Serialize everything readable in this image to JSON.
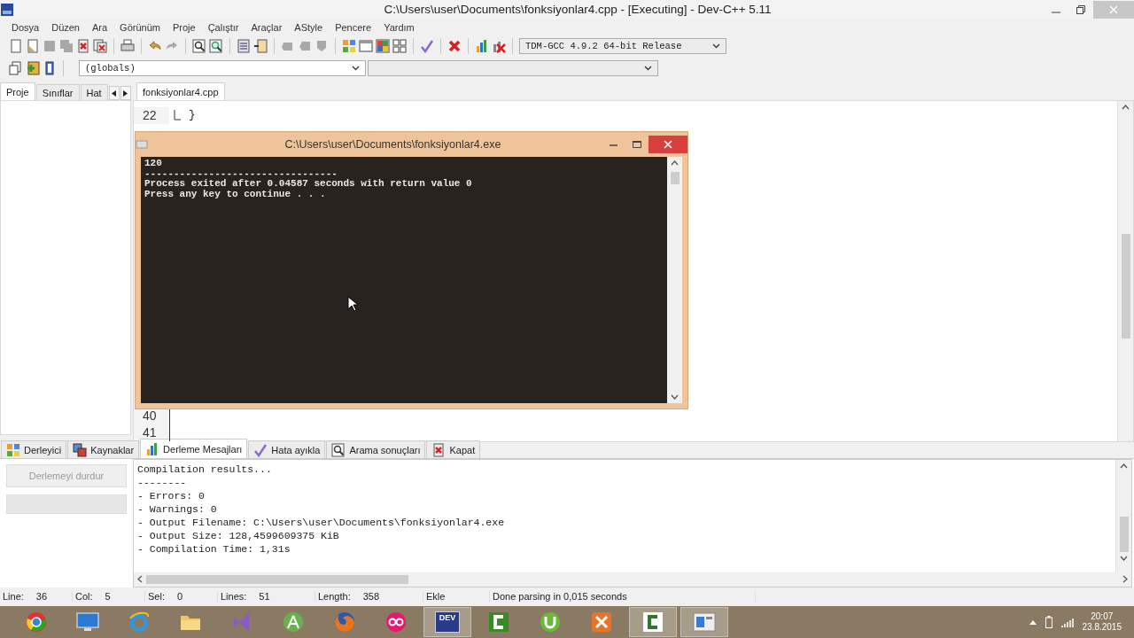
{
  "window": {
    "title": "C:\\Users\\user\\Documents\\fonksiyonlar4.cpp - [Executing] - Dev-C++ 5.11"
  },
  "menu": [
    "Dosya",
    "Düzen",
    "Ara",
    "Görünüm",
    "Proje",
    "Çalıştır",
    "Araçlar",
    "AStyle",
    "Pencere",
    "Yardım"
  ],
  "compiler_select": {
    "value": "TDM-GCC 4.9.2 64-bit Release"
  },
  "scope_select": {
    "value": "(globals)"
  },
  "left_tabs": [
    {
      "label": "Proje",
      "selected": true
    },
    {
      "label": "Sınıflar",
      "selected": false
    },
    {
      "label": "Hat",
      "selected": false
    }
  ],
  "editor_tabs": [
    {
      "label": "fonksiyonlar4.cpp",
      "selected": true
    }
  ],
  "editor_lines": [
    {
      "number": "22",
      "code": "}",
      "fold_end": true,
      "in_fold": false
    },
    {
      "number": "40",
      "fold_end": false,
      "in_fold": true
    },
    {
      "number": "41",
      "fold_end": false,
      "in_fold": true
    }
  ],
  "console": {
    "title": "C:\\Users\\user\\Documents\\fonksiyonlar4.exe",
    "lines": [
      "120",
      "---------------------------------",
      "Process exited after 0.04587 seconds with return value 0",
      "Press any key to continue . . ."
    ]
  },
  "bottom_tabs": [
    {
      "label": "Derleyici",
      "selected": false
    },
    {
      "label": "Kaynaklar",
      "selected": false
    },
    {
      "label": "Derleme Mesajları",
      "selected": true
    },
    {
      "label": "Hata ayıkla",
      "selected": false
    },
    {
      "label": "Arama sonuçları",
      "selected": false
    },
    {
      "label": "Kapat",
      "selected": false
    }
  ],
  "stop_button": {
    "label": "Derlemeyi durdur",
    "disabled": true
  },
  "progress": {
    "level": 0
  },
  "compile_log": [
    "Compilation results...",
    "--------",
    "- Errors: 0",
    "- Warnings: 0",
    "- Output Filename: C:\\Users\\user\\Documents\\fonksiyonlar4.exe",
    "- Output Size: 128,4599609375 KiB",
    "- Compilation Time: 1,31s"
  ],
  "status_bar": [
    {
      "label": "Line:",
      "value": "36"
    },
    {
      "label": "Col:",
      "value": "5"
    },
    {
      "label": "Sel:",
      "value": "0"
    },
    {
      "label": "Lines:",
      "value": "51"
    },
    {
      "label": "Length:",
      "value": "358"
    },
    {
      "label": "Ekle"
    },
    {
      "label": "Done parsing in 0,015 seconds"
    }
  ],
  "taskbar": [
    {
      "kind": "chrome",
      "active": false
    },
    {
      "kind": "monitor",
      "active": false
    },
    {
      "kind": "ie",
      "active": false
    },
    {
      "kind": "folder",
      "active": false
    },
    {
      "kind": "vs",
      "active": false
    },
    {
      "kind": "android",
      "active": false
    },
    {
      "kind": "firefox",
      "active": false
    },
    {
      "kind": "dots",
      "active": false
    },
    {
      "kind": "dev",
      "label": "DEV",
      "active": true
    },
    {
      "kind": "camtasia",
      "active": false
    },
    {
      "kind": "torrent",
      "active": false
    },
    {
      "kind": "xampp",
      "active": false
    },
    {
      "kind": "camtasia",
      "active": true
    },
    {
      "kind": "window",
      "active": true
    }
  ],
  "clock": {
    "time": "20:07",
    "date": "23.8.2015"
  }
}
